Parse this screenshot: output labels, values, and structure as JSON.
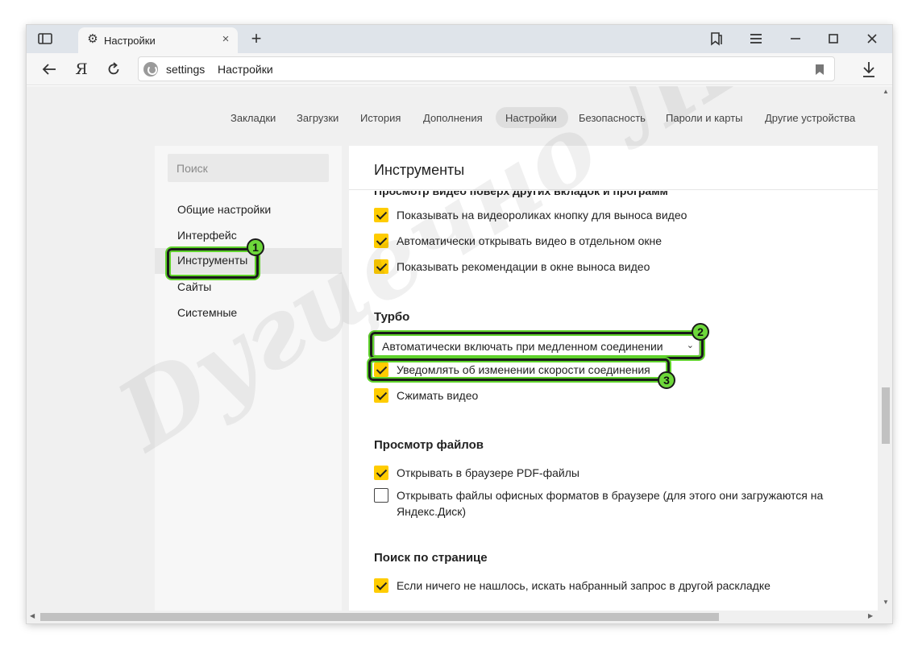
{
  "tab": {
    "title": "Настройки"
  },
  "address": {
    "domain": "settings",
    "title": "Настройки"
  },
  "topnav": {
    "items": [
      "Закладки",
      "Загрузки",
      "История",
      "Дополнения",
      "Настройки",
      "Безопасность",
      "Пароли и карты",
      "Другие устройства"
    ],
    "active": "Настройки"
  },
  "sidebar": {
    "search_placeholder": "Поиск",
    "items": [
      "Общие настройки",
      "Интерфейс",
      "Инструменты",
      "Сайты",
      "Системные"
    ],
    "active": "Инструменты"
  },
  "main": {
    "title": "Инструменты",
    "cut_section_title": "Просмотр видео поверх других вкладок и программ",
    "video_options": [
      {
        "label": "Показывать на видеороликах кнопку для выноса видео",
        "checked": true
      },
      {
        "label": "Автоматически открывать видео в отдельном окне",
        "checked": true
      },
      {
        "label": "Показывать рекомендации в окне выноса видео",
        "checked": true
      }
    ],
    "turbo": {
      "title": "Турбо",
      "select_value": "Автоматически включать при медленном соединении",
      "options": [
        {
          "label": "Уведомлять об изменении скорости соединения",
          "checked": true
        },
        {
          "label": "Сжимать видео",
          "checked": true
        }
      ]
    },
    "files": {
      "title": "Просмотр файлов",
      "options": [
        {
          "label": "Открывать в браузере PDF-файлы",
          "checked": true
        },
        {
          "label": "Открывать файлы офисных форматов в браузере (для этого они загружаются на Яндекс.Диск)",
          "checked": false
        }
      ]
    },
    "page_search": {
      "title": "Поиск по странице",
      "options": [
        {
          "label": "Если ничего не нашлось, искать набранный запрос в другой раскладке",
          "checked": true
        }
      ]
    }
  },
  "callouts": [
    "1",
    "2",
    "3"
  ],
  "accent_colors": {
    "checkbox": "#ffcc00",
    "highlight": "#5fd22b"
  },
  "watermark": "Dугцечно ЛIVE",
  "icons": [
    "tabs-panel-icon",
    "gear-icon",
    "close-icon",
    "plus-icon",
    "bookmarks-panel-icon",
    "menu-icon",
    "minimize-icon",
    "maximize-icon",
    "close-window-icon",
    "back-arrow-icon",
    "yandex-logo-icon",
    "reload-icon",
    "site-info-icon",
    "bookmark-flag-icon",
    "download-icon"
  ]
}
